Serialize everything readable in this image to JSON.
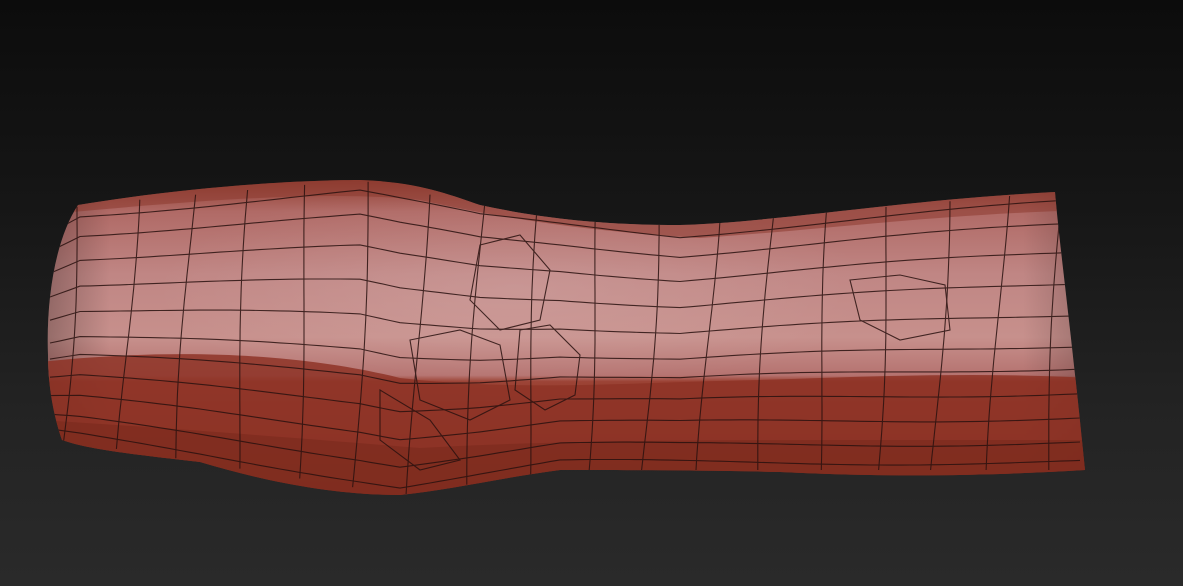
{
  "viewport": {
    "background_top": "#0c0c0c",
    "background_bottom": "#2a2a2a"
  },
  "model": {
    "kind": "polygon-mesh",
    "display": "polyframe-wireframe-on-shaded",
    "shape": "tube",
    "material_color_light": "#b97a78",
    "material_color_mid": "#a8504a",
    "material_color_dark": "#7a2a1e",
    "wire_color": "#2a1210"
  }
}
